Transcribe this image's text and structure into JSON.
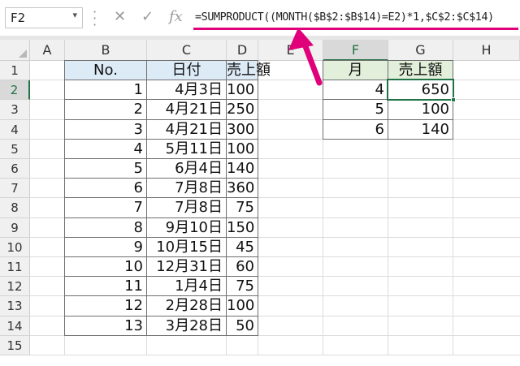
{
  "formula_bar": {
    "name_box": "F2",
    "cancel_icon": "cancel-icon",
    "enter_icon": "check-icon",
    "fx_label": "fx",
    "formula": "=SUMPRODUCT((MONTH($B$2:$B$14)=E2)*1,$C$2:$C$14)"
  },
  "columns": [
    "A",
    "B",
    "C",
    "D",
    "E",
    "F",
    "G",
    "H"
  ],
  "rows": [
    "1",
    "2",
    "3",
    "4",
    "5",
    "6",
    "7",
    "8",
    "9",
    "10",
    "11",
    "12",
    "13",
    "14",
    "15"
  ],
  "table1": {
    "headers": [
      "No.",
      "日付",
      "売上額"
    ],
    "rows": [
      [
        "1",
        "4月3日",
        "100"
      ],
      [
        "2",
        "4月21日",
        "250"
      ],
      [
        "3",
        "4月21日",
        "300"
      ],
      [
        "4",
        "5月11日",
        "100"
      ],
      [
        "5",
        "6月4日",
        "140"
      ],
      [
        "6",
        "7月8日",
        "360"
      ],
      [
        "7",
        "7月8日",
        "75"
      ],
      [
        "8",
        "9月10日",
        "150"
      ],
      [
        "9",
        "10月15日",
        "45"
      ],
      [
        "10",
        "12月31日",
        "60"
      ],
      [
        "11",
        "1月4日",
        "75"
      ],
      [
        "12",
        "2月28日",
        "100"
      ],
      [
        "13",
        "3月28日",
        "50"
      ]
    ]
  },
  "table2": {
    "headers": [
      "月",
      "売上額"
    ],
    "rows": [
      [
        "4",
        "650"
      ],
      [
        "5",
        "100"
      ],
      [
        "6",
        "140"
      ]
    ]
  },
  "selected": {
    "column": "F",
    "row": "2"
  },
  "colors": {
    "accent": "#217346",
    "highlight_arrow": "#e0007a",
    "header_blue": "#ddebf7",
    "header_green": "#e2efda"
  }
}
